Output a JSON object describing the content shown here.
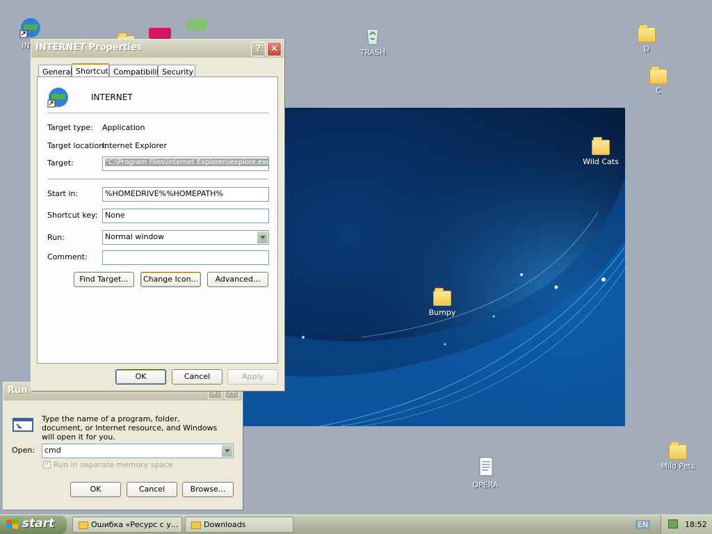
{
  "desktop": {
    "icons": {
      "internet": "INTE",
      "trash": "TRASH",
      "d": "D",
      "c": "C",
      "wild_cats": "Wild Cats",
      "bumpy": "Bumpy",
      "opera": "OPERA",
      "mild_pets": "Mild Pets"
    }
  },
  "properties": {
    "title": "INTERNET Properties",
    "help_glyph": "?",
    "close_glyph": "✕",
    "tabs": [
      "General",
      "Shortcut",
      "Compatibility",
      "Security"
    ],
    "name": "INTERNET",
    "target_type_label": "Target type:",
    "target_type_value": "Application",
    "target_location_label": "Target location:",
    "target_location_value": "Internet Explorer",
    "target_label": "Target:",
    "target_value": "\"C:\\Program Files\\Internet Explorer\\iexplore.exe\"",
    "start_in_label": "Start in:",
    "start_in_value": "%HOMEDRIVE%%HOMEPATH%",
    "shortcut_key_label": "Shortcut key:",
    "shortcut_key_value": "None",
    "run_label": "Run:",
    "run_value": "Normal window",
    "comment_label": "Comment:",
    "comment_value": "",
    "find_target": "Find Target...",
    "change_icon": "Change Icon...",
    "advanced": "Advanced...",
    "ok": "OK",
    "cancel": "Cancel",
    "apply": "Apply"
  },
  "run": {
    "title": "Run",
    "description": "Type the name of a program, folder, document, or Internet resource, and Windows will open it for you.",
    "open_label": "Open:",
    "open_value": "cmd",
    "separate_memory": "Run in separate memory space",
    "ok": "OK",
    "cancel": "Cancel",
    "browse": "Browse..."
  },
  "taskbar": {
    "start": "start",
    "tasks": [
      "Ошибка «Ресурс с у...",
      "Downloads"
    ],
    "language": "EN",
    "clock": "18:52"
  },
  "colors": {
    "desktop": "#a3acba",
    "window_face": "#ece9d8",
    "tab_highlight": "#e68b2c"
  }
}
